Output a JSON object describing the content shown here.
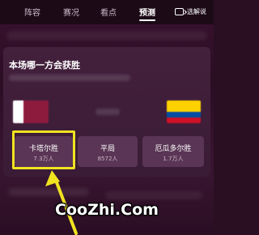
{
  "tabs": [
    {
      "label": "阵容"
    },
    {
      "label": "赛况"
    },
    {
      "label": "看点"
    },
    {
      "label": "预测"
    }
  ],
  "active_tab_index": 3,
  "header_button": {
    "label": "选解说",
    "icon": "switch-icon"
  },
  "card": {
    "title": "本场哪一方会获胜",
    "options": [
      {
        "name": "卡塔尔胜",
        "count": "7.3万人"
      },
      {
        "name": "平局",
        "count": "8572人"
      },
      {
        "name": "厄瓜多尔胜",
        "count": "1.7万人"
      }
    ],
    "highlighted_option": 0
  },
  "colors": {
    "highlight": "#f0e320",
    "background": "#2b0d24",
    "option_bg": "#5a3555"
  },
  "watermark": "CooZhi.Com"
}
